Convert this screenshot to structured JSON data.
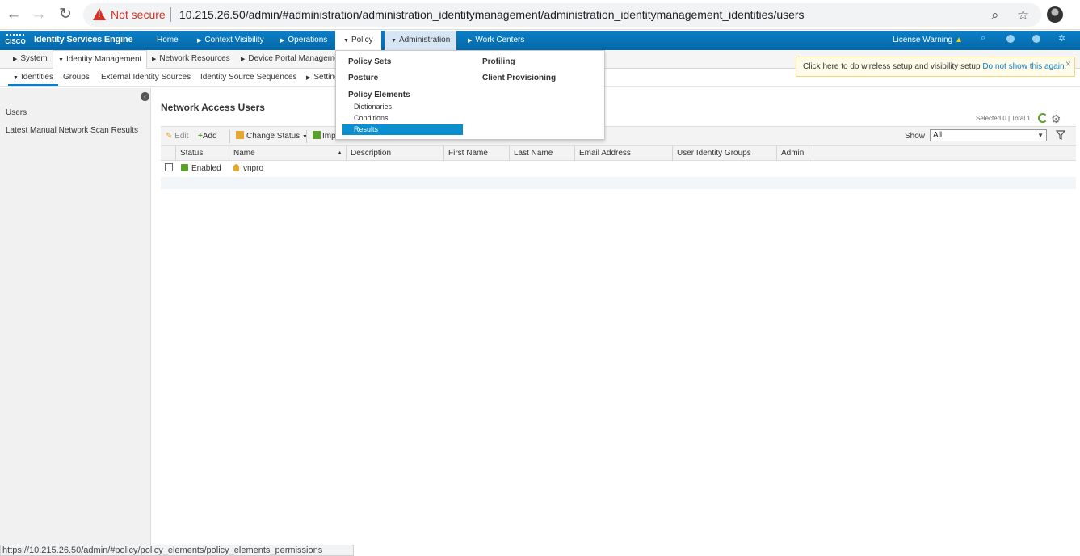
{
  "browser": {
    "back": "←",
    "forward": "→",
    "reload": "↻",
    "security_label": "Not secure",
    "url": "10.215.26.50/admin/#administration/administration_identitymanagement/administration_identitymanagement_identities/users",
    "zoom_icon": "⌕",
    "star_icon": "☆"
  },
  "topnav": {
    "logo_text": "CISCO",
    "product": "Identity Services Engine",
    "items": [
      {
        "label": "Home"
      },
      {
        "label": "Context Visibility"
      },
      {
        "label": "Operations"
      },
      {
        "label": "Policy"
      },
      {
        "label": "Administration"
      },
      {
        "label": "Work Centers"
      }
    ],
    "license": "License Warning",
    "license_icon": "▲"
  },
  "subnav1": {
    "items": [
      {
        "label": "System"
      },
      {
        "label": "Identity Management"
      },
      {
        "label": "Network Resources"
      },
      {
        "label": "Device Portal Management"
      }
    ]
  },
  "subnav2": {
    "items": [
      {
        "label": "Identities"
      },
      {
        "label": "Groups"
      },
      {
        "label": "External Identity Sources"
      },
      {
        "label": "Identity Source Sequences"
      },
      {
        "label": "Settings"
      }
    ]
  },
  "banner": {
    "text": "Click here to do wireless setup and visibility setup",
    "link": "Do not show this again.",
    "close": "×"
  },
  "sidebar": {
    "collapse_icon": "‹",
    "items": [
      {
        "label": "Users"
      },
      {
        "label": "Latest Manual Network Scan Results"
      }
    ]
  },
  "main": {
    "title": "Network Access Users",
    "selected": "Selected 0",
    "total": "Total 1",
    "toolbar": {
      "edit": "Edit",
      "add": "Add",
      "change_status": "Change Status",
      "import": "Import"
    },
    "show_label": "Show",
    "show_value": "All",
    "columns": [
      "Status",
      "Name",
      "Description",
      "First Name",
      "Last Name",
      "Email Address",
      "User Identity Groups",
      "Admin"
    ],
    "rows": [
      {
        "status": "Enabled",
        "name": "vnpro",
        "description": "",
        "first_name": "",
        "last_name": "",
        "email": "",
        "groups": "",
        "admin": ""
      }
    ]
  },
  "policy_menu": {
    "col1": {
      "policy_sets": "Policy Sets",
      "posture": "Posture",
      "policy_elements": "Policy Elements",
      "dictionaries": "Dictionaries",
      "conditions": "Conditions",
      "results": "Results"
    },
    "col2": {
      "profiling": "Profiling",
      "client_provisioning": "Client Provisioning"
    }
  },
  "statusbar": {
    "text": "https://10.215.26.50/admin/#policy/policy_elements/policy_elements_permissions"
  },
  "colors": {
    "brand_blue": "#0a7fc8",
    "highlight": "#0a90d0",
    "warning": "#d93025",
    "enabled": "#5aa02c"
  }
}
